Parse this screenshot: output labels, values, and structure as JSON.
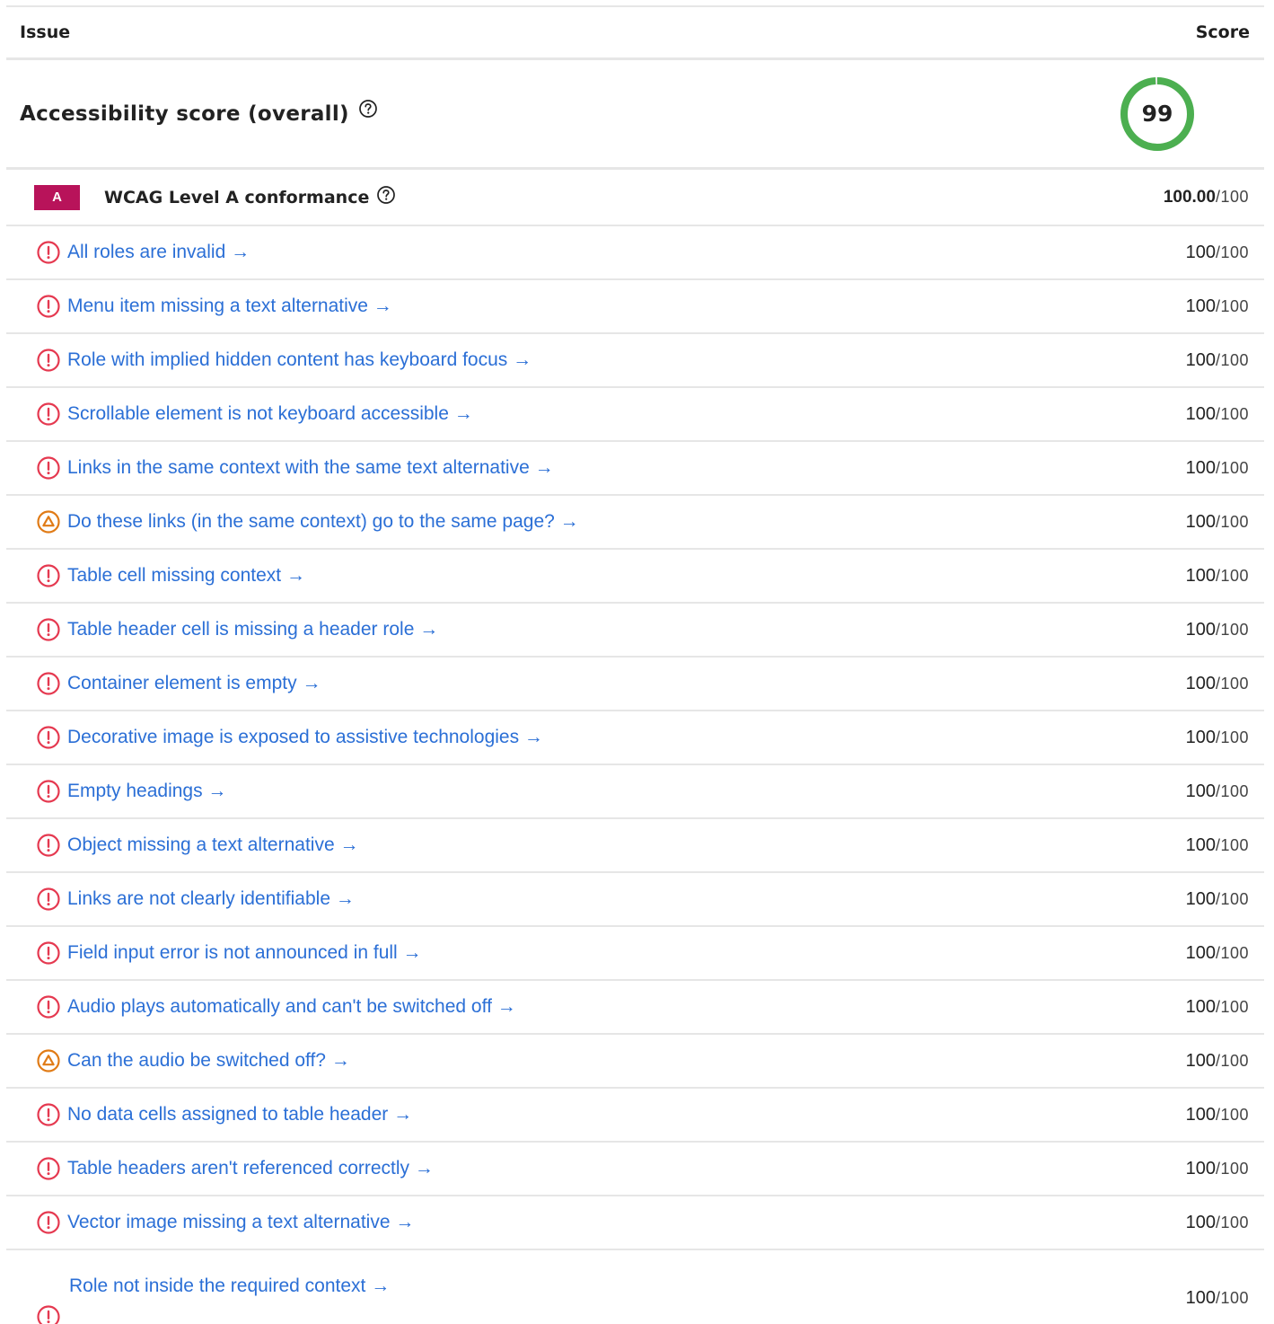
{
  "header": {
    "issue_label": "Issue",
    "score_label": "Score"
  },
  "overall": {
    "title": "Accessibility score (overall)",
    "score": "99",
    "score_value": 99,
    "gauge_color": "#4caf50"
  },
  "level": {
    "badge": "A",
    "title": "WCAG Level A conformance",
    "score": "100.00",
    "max": "/100",
    "badge_color": "#b8135a"
  },
  "colors": {
    "link": "#2b6fd6",
    "error": "#e53950",
    "warning": "#e07b16"
  },
  "issues": [
    {
      "label": "All roles are invalid →",
      "severity": "error",
      "score": "100",
      "max": "/100"
    },
    {
      "label": "Menu item missing a text alternative →",
      "severity": "error",
      "score": "100",
      "max": "/100"
    },
    {
      "label": "Role with implied hidden content has keyboard focus →",
      "severity": "error",
      "score": "100",
      "max": "/100"
    },
    {
      "label": "Scrollable element is not keyboard accessible →",
      "severity": "error",
      "score": "100",
      "max": "/100"
    },
    {
      "label": "Links in the same context with the same text alternative →",
      "severity": "error",
      "score": "100",
      "max": "/100"
    },
    {
      "label": "Do these links (in the same context) go to the same page? →",
      "severity": "warning",
      "score": "100",
      "max": "/100"
    },
    {
      "label": "Table cell missing context →",
      "severity": "error",
      "score": "100",
      "max": "/100"
    },
    {
      "label": "Table header cell is missing a header role →",
      "severity": "error",
      "score": "100",
      "max": "/100"
    },
    {
      "label": "Container element is empty →",
      "severity": "error",
      "score": "100",
      "max": "/100"
    },
    {
      "label": "Decorative image is exposed to assistive technologies →",
      "severity": "error",
      "score": "100",
      "max": "/100"
    },
    {
      "label": "Empty headings →",
      "severity": "error",
      "score": "100",
      "max": "/100"
    },
    {
      "label": "Object missing a text alternative →",
      "severity": "error",
      "score": "100",
      "max": "/100"
    },
    {
      "label": "Links are not clearly identifiable →",
      "severity": "error",
      "score": "100",
      "max": "/100"
    },
    {
      "label": "Field input error is not announced in full →",
      "severity": "error",
      "score": "100",
      "max": "/100"
    },
    {
      "label": "Audio plays automatically and can't be switched off →",
      "severity": "error",
      "score": "100",
      "max": "/100"
    },
    {
      "label": "Can the audio be switched off? →",
      "severity": "warning",
      "score": "100",
      "max": "/100"
    },
    {
      "label": "No data cells assigned to table header →",
      "severity": "error",
      "score": "100",
      "max": "/100"
    },
    {
      "label": "Table headers aren't referenced correctly →",
      "severity": "error",
      "score": "100",
      "max": "/100"
    },
    {
      "label": "Vector image missing a text alternative →",
      "severity": "error",
      "score": "100",
      "max": "/100"
    },
    {
      "label": "Role not inside the required context →",
      "severity": "error",
      "score": "100",
      "max": "/100"
    }
  ]
}
